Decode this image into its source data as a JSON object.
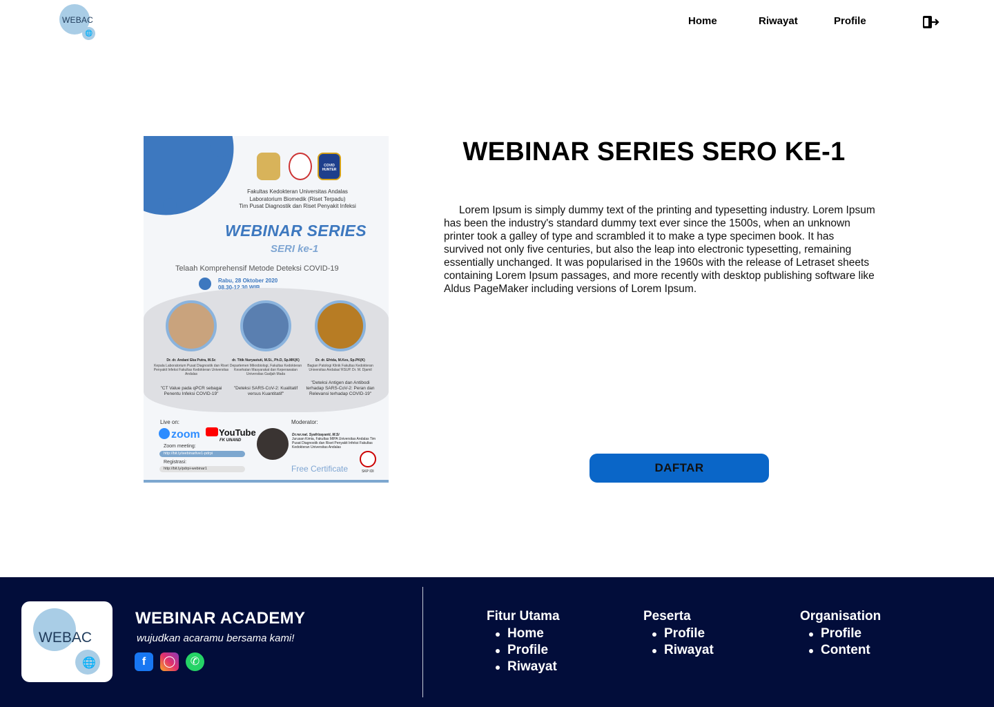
{
  "header": {
    "logo_text": "WEBAC",
    "nav": [
      "Home",
      "Riwayat",
      "Profile"
    ],
    "logout_icon": "logout-icon"
  },
  "poster": {
    "institutions": "Fakultas Kedokteran Universitas Andalas\nLaboratorium Biomedik (Riset Terpadu)\nTim Pusat Diagnostik dan Riset Penyakit Infeksi",
    "badge": "COVID HUNTER",
    "headline": "WEBINAR SERIES",
    "subheadline": "SERI ke-1",
    "theme": "Telaah Komprehensif Metode Deteksi COVID-19",
    "date": "Rabu, 28 Oktober 2020",
    "time": "08.30-12.30 WIB",
    "speakers": [
      {
        "name": "Dr. dr. Andani Eka Putra, M.Sc",
        "desc": "Kepala Laboratorium Pusat Diagnostik dan Riset Penyakit Infeksi Fakultas Kedokteran Universitas Andalas",
        "topic": "\"CT Value pada qPCR sebagai Penentu Infeksi COVID-19\""
      },
      {
        "name": "dr. Titik Nuryastuti, M.Si., Ph.D, Sp.MK(K)",
        "desc": "Departemen Mikrobiologi, Fakultas Kedokteran Kesehatan Masyarakat dan Keperawatan Universitas Gadjah Mada",
        "topic": "\"Deteksi SARS-CoV-2: Kualitatif versus Kuantitatif\""
      },
      {
        "name": "Dr. dr. Efrida, M.Kes, Sp.PK(K)",
        "desc": "Bagian Patologi Klinik Fakultas Kedokteran Universitas Andalas/ RSUP. Dr. M. Djamil",
        "topic": "\"Deteksi Antigen dan Antibodi terhadap SARS-CoV-2: Peran dan Relevansi terhadap COVID-19\""
      }
    ],
    "live_on": "Live on:",
    "zoom": "zoom",
    "youtube": "YouTube",
    "youtube_sub": "FK UNAND",
    "zoom_meeting_label": "Zoom meeting:",
    "zoom_link": "http://bit.ly/webinarlive1-pdrpi",
    "registration_label": "Registrasi:",
    "registration_link": "http://bit.ly/pdrpi-webinar1",
    "moderator_label": "Moderator:",
    "moderator_name": "Dr.rer.nat. Syafrizayanti, M.Si",
    "moderator_desc": "Jurusan Kimia, Fakultas MIPA Universitas Andalas Tim Pusat Diagnostik dan Riset Penyakit Infeksi Fakultas Kedokteran Universitas Andalas",
    "certificate": "Free Certificate",
    "skp": "SKP IDI"
  },
  "detail": {
    "title": "WEBINAR SERIES SERO KE-1",
    "description": "Lorem Ipsum is simply dummy text of the printing and typesetting industry. Lorem Ipsum has been the industry's standard dummy text ever since the 1500s, when an unknown printer took a galley of type and scrambled it to make a type specimen book. It has survived not only five centuries, but also the leap into electronic typesetting, remaining essentially unchanged. It was popularised in the 1960s with the release of Letraset sheets containing Lorem Ipsum passages, and more recently with desktop publishing software like Aldus PageMaker including versions of Lorem Ipsum.",
    "button": "DAFTAR",
    "button_color": "#0a66c8"
  },
  "footer": {
    "logo_text": "WEBAC",
    "name": "WEBINAR ACADEMY",
    "tagline": "wujudkan acaramu bersama kami!",
    "social": [
      "facebook-icon",
      "instagram-icon",
      "whatsapp-icon"
    ],
    "columns": [
      {
        "title": "Fitur Utama",
        "items": [
          "Home",
          "Profile",
          "Riwayat"
        ]
      },
      {
        "title": "Peserta",
        "items": [
          "Profile",
          "Riwayat"
        ]
      },
      {
        "title": "Organisation",
        "items": [
          "Profile",
          "Content"
        ]
      }
    ],
    "background": "#020d3a"
  }
}
